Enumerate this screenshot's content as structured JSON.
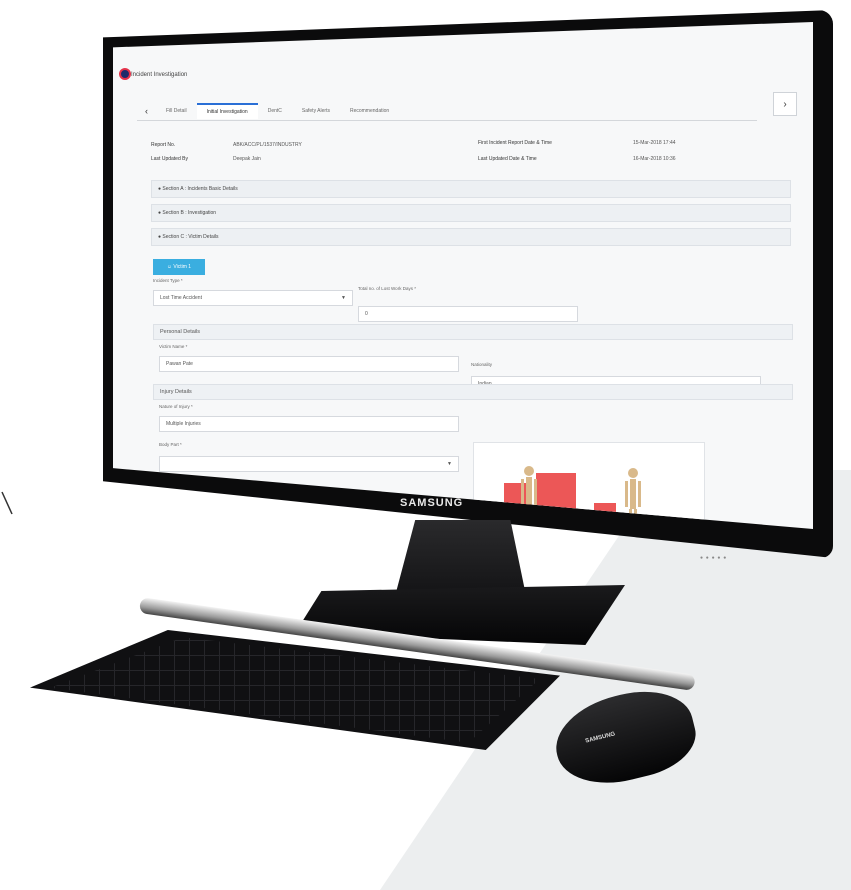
{
  "app": {
    "title": "Incident Investigation"
  },
  "tabs": [
    {
      "label": "Fill Detail"
    },
    {
      "label": "Initial Investigation",
      "active": true
    },
    {
      "label": "DentC"
    },
    {
      "label": "Safety Alerts"
    },
    {
      "label": "Recommendation"
    }
  ],
  "report": {
    "report_no_label": "Report No.",
    "report_no_value": "ABK/ACC/PL/1537/INDUSTRY",
    "last_updated_by_label": "Last Updated By",
    "last_updated_by_value": "Deepak Jain",
    "first_report_label": "First Incident Report Date & Time",
    "first_report_value": "15-Mar-2018 17:44",
    "last_updated_label": "Last Updated Date & Time",
    "last_updated_value": "16-Mar-2018 10:36"
  },
  "sections": [
    {
      "label": "Section A : Incidents Basic Details"
    },
    {
      "label": "Section B : Investigation"
    },
    {
      "label": "Section C : Victim Details"
    }
  ],
  "victim": {
    "button_label": "Victim 1",
    "incident_type_label": "Incident Type *",
    "incident_type_value": "Lost Time Accident",
    "lost_days_label": "Total no. of Lost Work Days *",
    "lost_days_value": "0",
    "personal_details_label": "Personal Details",
    "victim_name_label": "Victim Name *",
    "victim_name_value": "Pawan Pate",
    "nationality_label": "Nationality",
    "nationality_value": "Indian",
    "injury_details_label": "Injury Details",
    "nature_label": "Nature of Injury *",
    "nature_value": "Multiple Injuries",
    "body_part_label": "Body Part *"
  },
  "hardware": {
    "monitor_brand": "SAMSUNG",
    "mouse_brand": "SAMSUNG"
  },
  "icons": {
    "prev": "chevron-left-icon",
    "next": "chevron-right-icon",
    "section": "circle-plus-icon",
    "user": "user-icon",
    "dropdown": "caret-down-icon"
  }
}
